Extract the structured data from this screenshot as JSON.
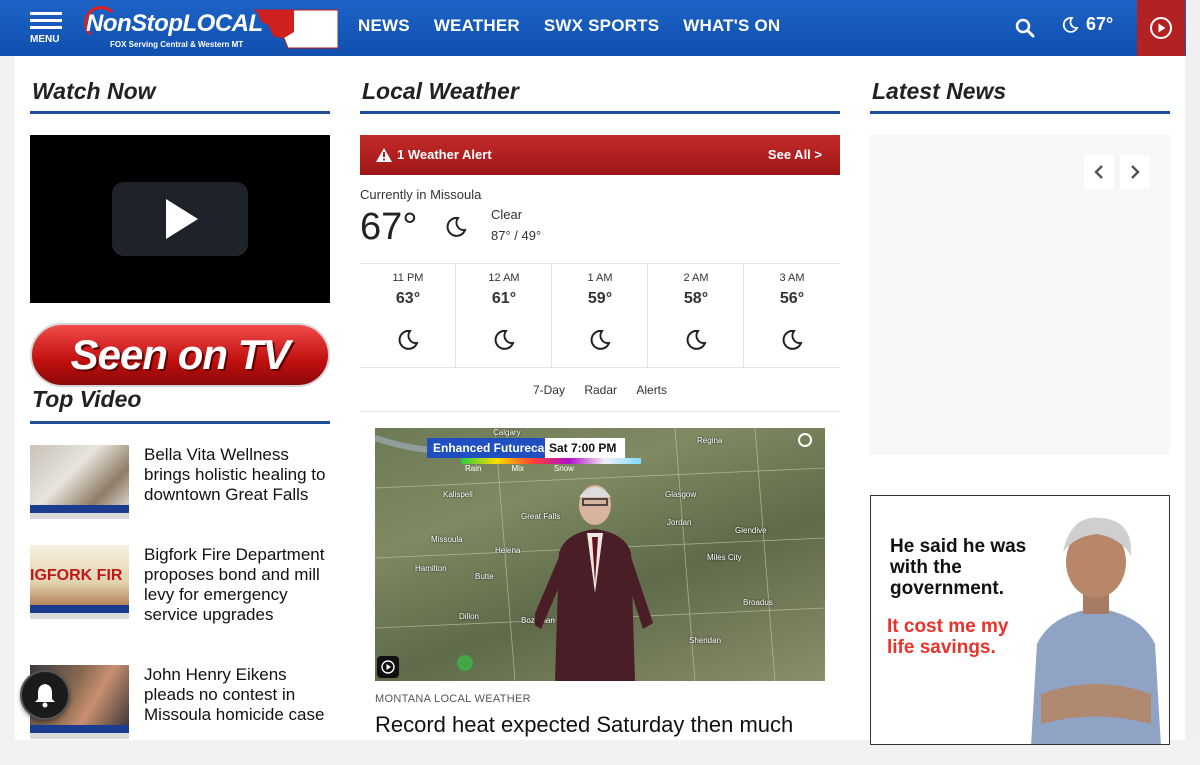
{
  "header": {
    "menu_label": "MENU",
    "logo_text": "NonStop",
    "logo_text_bold": "LOCAL",
    "logo_tag": "FOX Serving Central & Western MT",
    "nav": [
      "NEWS",
      "WEATHER",
      "SWX SPORTS",
      "WHAT'S ON"
    ],
    "temp": "67°"
  },
  "watch_now": {
    "title": "Watch Now"
  },
  "seen_on_tv": "Seen on TV",
  "top_video": {
    "title": "Top Video",
    "stories": [
      {
        "headline": "Bella Vita Wellness brings holistic healing to downtown Great Falls"
      },
      {
        "headline": "Bigfork Fire Department proposes bond and mill levy for emergency service upgrades",
        "thumb_text": "IGFORK FIR"
      },
      {
        "headline": "John Henry Eikens pleads no contest in Missoula homicide case"
      }
    ]
  },
  "weather": {
    "title": "Local Weather",
    "alert_text": "1 Weather Alert",
    "alert_link": "See All >",
    "current_label": "Currently in Missoula",
    "current_temp": "67°",
    "condition": "Clear",
    "hilo": "87° / 49°",
    "hourly": [
      {
        "time": "11 PM",
        "temp": "63°"
      },
      {
        "time": "12 AM",
        "temp": "61°"
      },
      {
        "time": "1 AM",
        "temp": "59°"
      },
      {
        "time": "2 AM",
        "temp": "58°"
      },
      {
        "time": "3 AM",
        "temp": "56°"
      }
    ],
    "links": [
      "7-Day",
      "Radar",
      "Alerts"
    ],
    "video": {
      "overlay_title": "Enhanced Futurecast",
      "overlay_time": "Sat 7:00 PM",
      "legend": [
        "Rain",
        "Mix",
        "Snow"
      ],
      "cities": [
        "Calgary",
        "Regina",
        "Kalispell",
        "Glasgow",
        "Great Falls",
        "Jordan",
        "Missoula",
        "Helena",
        "Glendive",
        "Hamilton",
        "Butte",
        "Miles City",
        "Bozeman",
        "Broadus",
        "Dillon",
        "Sheridan"
      ]
    },
    "kicker": "MONTANA LOCAL WEATHER",
    "headline": "Record heat expected Saturday then much"
  },
  "latest_news": {
    "title": "Latest News"
  },
  "ad": {
    "line1": "He said he was with the government.",
    "line2": "It cost me my life savings."
  },
  "colors": {
    "brand_blue": "#1f4e9c",
    "alert_red": "#b22222",
    "header_blue": "#1558b8"
  }
}
